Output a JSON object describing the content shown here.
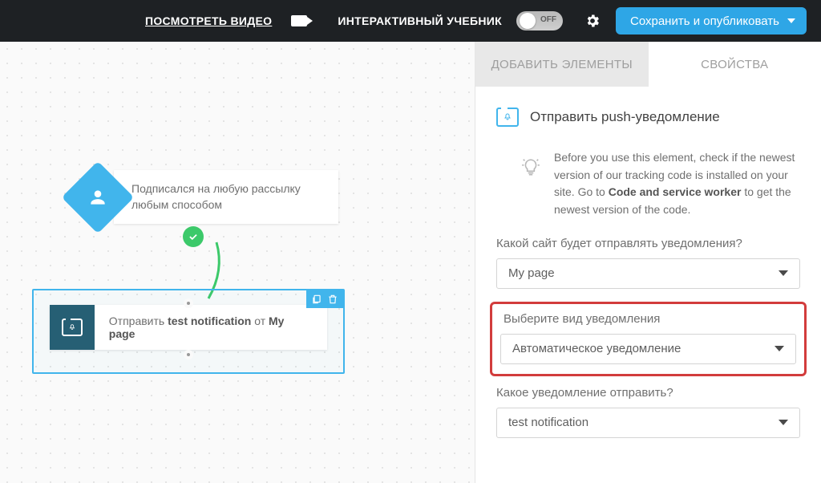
{
  "header": {
    "watch_video": "ПОСМОТРЕТЬ ВИДЕО",
    "tutorial": "ИНТЕРАКТИВНЫЙ УЧЕБНИК",
    "toggle_off": "OFF",
    "save_publish": "Сохранить и опубликовать"
  },
  "sidebar": {
    "tab_add": "ДОБАВИТЬ ЭЛЕМЕНТЫ",
    "tab_props": "СВОЙСТВА",
    "panel_title": "Отправить push-уведомление",
    "info_pre": "Before you use this element, check if the newest version of our tracking code is installed on your site. Go to ",
    "info_bold": "Code and service worker",
    "info_post": " to get the newest version of the code.",
    "field1_label": "Какой сайт будет отправлять уведомления?",
    "field1_value": "My page",
    "field2_label": "Выберите вид уведомления",
    "field2_value": "Автоматическое уведомление",
    "field3_label": "Какое уведомление отправить?",
    "field3_value": "test notification"
  },
  "canvas": {
    "trigger_text": "Подписался на любую рассылку любым способом",
    "action_prefix": "Отправить ",
    "action_b1": "test notification",
    "action_mid": " от ",
    "action_b2": "My page"
  }
}
